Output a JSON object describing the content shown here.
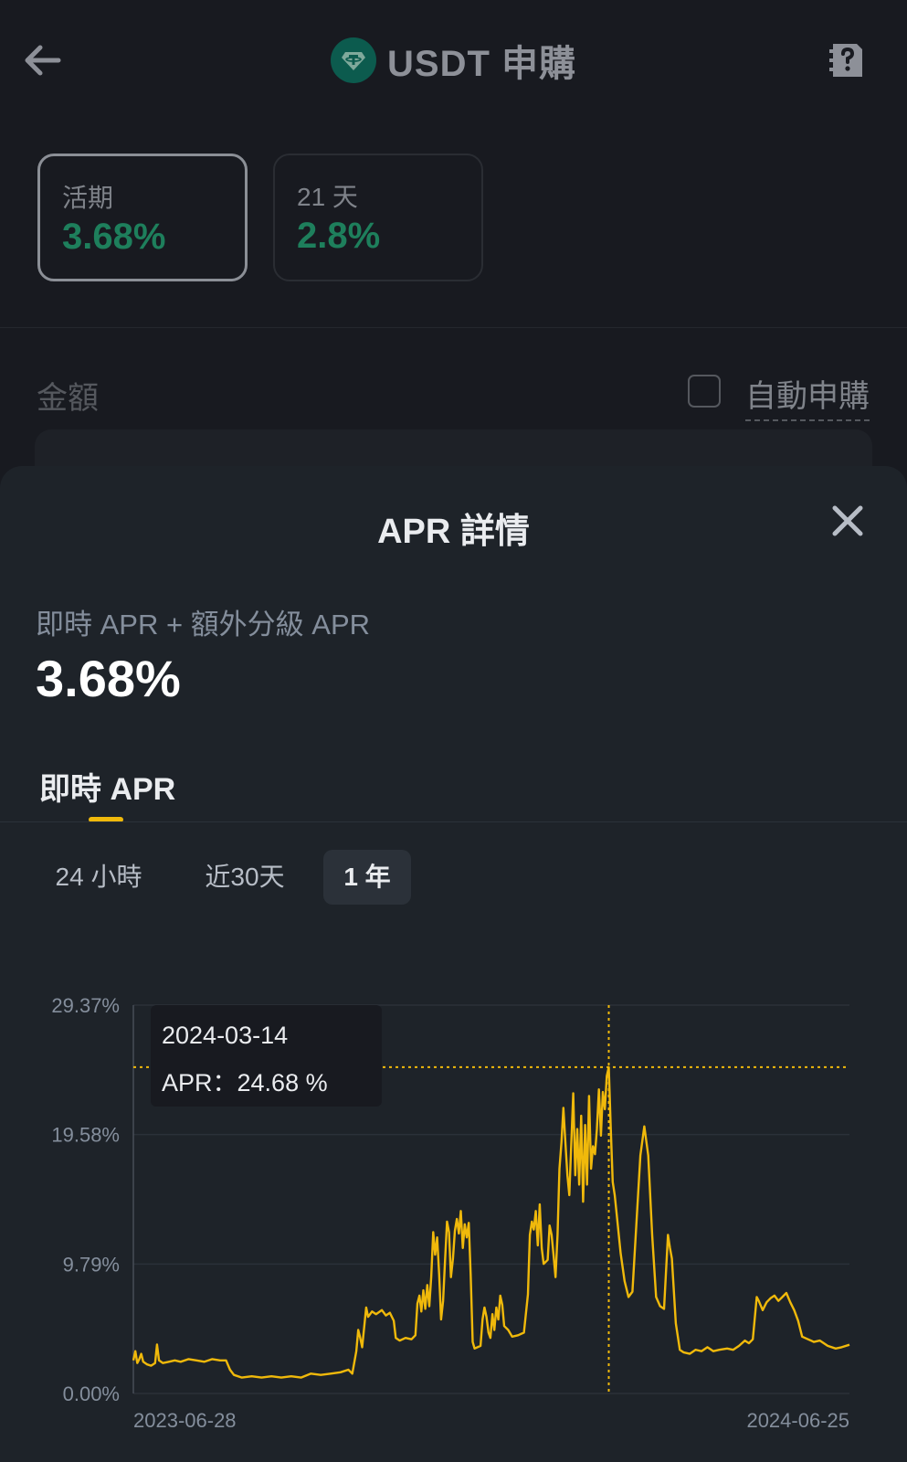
{
  "header": {
    "title": "USDT 申購"
  },
  "products": [
    {
      "label": "活期",
      "apr": "3.68%"
    },
    {
      "label": "21 天",
      "apr": "2.8%"
    }
  ],
  "amount": {
    "label": "金額",
    "auto_subscribe_label": "自動申購"
  },
  "sheet": {
    "title": "APR 詳情",
    "apr_caption": "即時 APR + 額外分級 APR",
    "apr_value": "3.68%",
    "tab": "即時 APR",
    "ranges": [
      "24 小時",
      "近30天",
      "1 年"
    ],
    "selected_range": "1 年"
  },
  "tooltip": {
    "date": "2024-03-14",
    "apr": "APR：24.68 %"
  },
  "colors": {
    "accent": "#f0b90b",
    "positive": "#1e7f5c",
    "sheet_bg": "#1e2329",
    "page_bg": "#181a20"
  },
  "chart_data": {
    "type": "line",
    "x_start": "2023-06-28",
    "x_end": "2024-06-25",
    "x_tick_labels": [
      "2023-06-28",
      "2024-06-25"
    ],
    "y_tick_labels": [
      "29.37%",
      "19.58%",
      "9.79%",
      "0.00%"
    ],
    "y_ticks": [
      29.37,
      19.58,
      9.79,
      0.0
    ],
    "ylim": [
      0,
      29.37
    ],
    "grid": true,
    "highlight": {
      "date": "2024-03-14",
      "value": 24.68
    },
    "series": [
      {
        "color": "#f0b90b",
        "points": [
          [
            "2023-06-28",
            2.5
          ],
          [
            "2023-06-29",
            3.2
          ],
          [
            "2023-06-30",
            2.3
          ],
          [
            "2023-07-01",
            2.6
          ],
          [
            "2023-07-02",
            3.0
          ],
          [
            "2023-07-03",
            2.4
          ],
          [
            "2023-07-05",
            2.2
          ],
          [
            "2023-07-07",
            2.1
          ],
          [
            "2023-07-09",
            2.3
          ],
          [
            "2023-07-10",
            3.7
          ],
          [
            "2023-07-11",
            2.5
          ],
          [
            "2023-07-13",
            2.3
          ],
          [
            "2023-07-16",
            2.4
          ],
          [
            "2023-07-19",
            2.5
          ],
          [
            "2023-07-22",
            2.4
          ],
          [
            "2023-07-26",
            2.6
          ],
          [
            "2023-07-30",
            2.5
          ],
          [
            "2023-08-03",
            2.4
          ],
          [
            "2023-08-07",
            2.6
          ],
          [
            "2023-08-11",
            2.5
          ],
          [
            "2023-08-14",
            2.5
          ],
          [
            "2023-08-16",
            1.8
          ],
          [
            "2023-08-18",
            1.4
          ],
          [
            "2023-08-22",
            1.2
          ],
          [
            "2023-08-27",
            1.3
          ],
          [
            "2023-09-01",
            1.2
          ],
          [
            "2023-09-06",
            1.3
          ],
          [
            "2023-09-11",
            1.2
          ],
          [
            "2023-09-16",
            1.3
          ],
          [
            "2023-09-21",
            1.2
          ],
          [
            "2023-09-26",
            1.5
          ],
          [
            "2023-10-01",
            1.4
          ],
          [
            "2023-10-06",
            1.5
          ],
          [
            "2023-10-11",
            1.6
          ],
          [
            "2023-10-15",
            1.8
          ],
          [
            "2023-10-17",
            1.5
          ],
          [
            "2023-10-19",
            3.2
          ],
          [
            "2023-10-20",
            4.8
          ],
          [
            "2023-10-21",
            4.2
          ],
          [
            "2023-10-22",
            3.5
          ],
          [
            "2023-10-24",
            6.5
          ],
          [
            "2023-10-25",
            5.8
          ],
          [
            "2023-10-27",
            6.2
          ],
          [
            "2023-10-29",
            6.0
          ],
          [
            "2023-11-01",
            6.3
          ],
          [
            "2023-11-03",
            5.9
          ],
          [
            "2023-11-05",
            6.1
          ],
          [
            "2023-11-07",
            5.5
          ],
          [
            "2023-11-08",
            4.2
          ],
          [
            "2023-11-10",
            4.0
          ],
          [
            "2023-11-13",
            4.2
          ],
          [
            "2023-11-16",
            4.1
          ],
          [
            "2023-11-18",
            4.4
          ],
          [
            "2023-11-19",
            6.8
          ],
          [
            "2023-11-20",
            7.4
          ],
          [
            "2023-11-21",
            6.2
          ],
          [
            "2023-11-22",
            7.8
          ],
          [
            "2023-11-23",
            6.4
          ],
          [
            "2023-11-24",
            8.2
          ],
          [
            "2023-11-25",
            6.6
          ],
          [
            "2023-11-26",
            8.8
          ],
          [
            "2023-11-27",
            12.2
          ],
          [
            "2023-11-28",
            10.5
          ],
          [
            "2023-11-29",
            11.8
          ],
          [
            "2023-11-30",
            9.0
          ],
          [
            "2023-12-01",
            5.6
          ],
          [
            "2023-12-02",
            7.0
          ],
          [
            "2023-12-03",
            10.0
          ],
          [
            "2023-12-04",
            13.0
          ],
          [
            "2023-12-05",
            12.2
          ],
          [
            "2023-12-06",
            8.8
          ],
          [
            "2023-12-07",
            10.2
          ],
          [
            "2023-12-08",
            12.3
          ],
          [
            "2023-12-09",
            13.2
          ],
          [
            "2023-12-10",
            12.1
          ],
          [
            "2023-12-11",
            13.8
          ],
          [
            "2023-12-12",
            11.0
          ],
          [
            "2023-12-13",
            12.8
          ],
          [
            "2023-12-14",
            11.8
          ],
          [
            "2023-12-15",
            12.9
          ],
          [
            "2023-12-16",
            9.0
          ],
          [
            "2023-12-17",
            3.9
          ],
          [
            "2023-12-18",
            3.4
          ],
          [
            "2023-12-21",
            3.6
          ],
          [
            "2023-12-22",
            5.6
          ],
          [
            "2023-12-23",
            6.5
          ],
          [
            "2023-12-24",
            5.8
          ],
          [
            "2023-12-25",
            4.6
          ],
          [
            "2023-12-26",
            4.2
          ],
          [
            "2023-12-27",
            6.0
          ],
          [
            "2023-12-28",
            4.8
          ],
          [
            "2023-12-29",
            6.5
          ],
          [
            "2023-12-30",
            5.6
          ],
          [
            "2023-12-31",
            7.4
          ],
          [
            "2024-01-01",
            6.7
          ],
          [
            "2024-01-02",
            5.1
          ],
          [
            "2024-01-04",
            4.8
          ],
          [
            "2024-01-06",
            4.3
          ],
          [
            "2024-01-09",
            4.4
          ],
          [
            "2024-01-12",
            4.6
          ],
          [
            "2024-01-14",
            7.5
          ],
          [
            "2024-01-15",
            12.0
          ],
          [
            "2024-01-16",
            13.0
          ],
          [
            "2024-01-17",
            12.4
          ],
          [
            "2024-01-18",
            13.8
          ],
          [
            "2024-01-19",
            11.2
          ],
          [
            "2024-01-20",
            14.3
          ],
          [
            "2024-01-21",
            11.0
          ],
          [
            "2024-01-22",
            9.8
          ],
          [
            "2024-01-24",
            10.1
          ],
          [
            "2024-01-25",
            12.7
          ],
          [
            "2024-01-26",
            12.0
          ],
          [
            "2024-01-27",
            10.5
          ],
          [
            "2024-01-28",
            8.8
          ],
          [
            "2024-01-29",
            12.0
          ],
          [
            "2024-01-30",
            17.0
          ],
          [
            "2024-01-31",
            19.0
          ],
          [
            "2024-02-01",
            21.6
          ],
          [
            "2024-02-02",
            19.0
          ],
          [
            "2024-02-03",
            16.5
          ],
          [
            "2024-02-04",
            15.0
          ],
          [
            "2024-02-05",
            19.0
          ],
          [
            "2024-02-06",
            22.7
          ],
          [
            "2024-02-07",
            16.5
          ],
          [
            "2024-02-08",
            20.0
          ],
          [
            "2024-02-09",
            15.8
          ],
          [
            "2024-02-10",
            21.0
          ],
          [
            "2024-02-11",
            14.5
          ],
          [
            "2024-02-12",
            20.3
          ],
          [
            "2024-02-13",
            15.8
          ],
          [
            "2024-02-14",
            22.5
          ],
          [
            "2024-02-15",
            17.0
          ],
          [
            "2024-02-16",
            18.7
          ],
          [
            "2024-02-17",
            18.1
          ],
          [
            "2024-02-18",
            20.0
          ],
          [
            "2024-02-19",
            23.0
          ],
          [
            "2024-02-20",
            19.5
          ],
          [
            "2024-02-21",
            22.8
          ],
          [
            "2024-02-22",
            21.5
          ],
          [
            "2024-02-23",
            24.0
          ],
          [
            "2024-02-24",
            24.68
          ],
          [
            "2024-02-25",
            20.0
          ],
          [
            "2024-02-26",
            16.0
          ],
          [
            "2024-02-27",
            15.0
          ],
          [
            "2024-02-28",
            13.6
          ],
          [
            "2024-03-01",
            10.6
          ],
          [
            "2024-03-03",
            8.5
          ],
          [
            "2024-03-05",
            7.3
          ],
          [
            "2024-03-07",
            7.7
          ],
          [
            "2024-03-09",
            12.8
          ],
          [
            "2024-03-11",
            18.0
          ],
          [
            "2024-03-13",
            20.2
          ],
          [
            "2024-03-15",
            18.0
          ],
          [
            "2024-03-17",
            12.0
          ],
          [
            "2024-03-19",
            7.3
          ],
          [
            "2024-03-21",
            6.6
          ],
          [
            "2024-03-23",
            6.4
          ],
          [
            "2024-03-25",
            12.0
          ],
          [
            "2024-03-26",
            11.0
          ],
          [
            "2024-03-27",
            10.2
          ],
          [
            "2024-03-29",
            5.3
          ],
          [
            "2024-03-31",
            3.3
          ],
          [
            "2024-04-02",
            3.1
          ],
          [
            "2024-04-05",
            3.0
          ],
          [
            "2024-04-08",
            3.3
          ],
          [
            "2024-04-11",
            3.2
          ],
          [
            "2024-04-14",
            3.5
          ],
          [
            "2024-04-17",
            3.2
          ],
          [
            "2024-04-20",
            3.3
          ],
          [
            "2024-04-24",
            3.4
          ],
          [
            "2024-04-27",
            3.3
          ],
          [
            "2024-04-30",
            3.6
          ],
          [
            "2024-05-03",
            4.0
          ],
          [
            "2024-05-05",
            3.8
          ],
          [
            "2024-05-07",
            4.1
          ],
          [
            "2024-05-09",
            7.3
          ],
          [
            "2024-05-10",
            7.0
          ],
          [
            "2024-05-12",
            6.3
          ],
          [
            "2024-05-14",
            6.9
          ],
          [
            "2024-05-16",
            7.2
          ],
          [
            "2024-05-18",
            7.4
          ],
          [
            "2024-05-20",
            7.0
          ],
          [
            "2024-05-22",
            7.3
          ],
          [
            "2024-05-24",
            7.6
          ],
          [
            "2024-05-26",
            6.9
          ],
          [
            "2024-05-28",
            6.3
          ],
          [
            "2024-05-30",
            5.5
          ],
          [
            "2024-06-01",
            4.3
          ],
          [
            "2024-06-04",
            4.1
          ],
          [
            "2024-06-07",
            3.9
          ],
          [
            "2024-06-10",
            4.0
          ],
          [
            "2024-06-14",
            3.6
          ],
          [
            "2024-06-18",
            3.4
          ],
          [
            "2024-06-21",
            3.5
          ],
          [
            "2024-06-25",
            3.68
          ]
        ]
      }
    ]
  }
}
